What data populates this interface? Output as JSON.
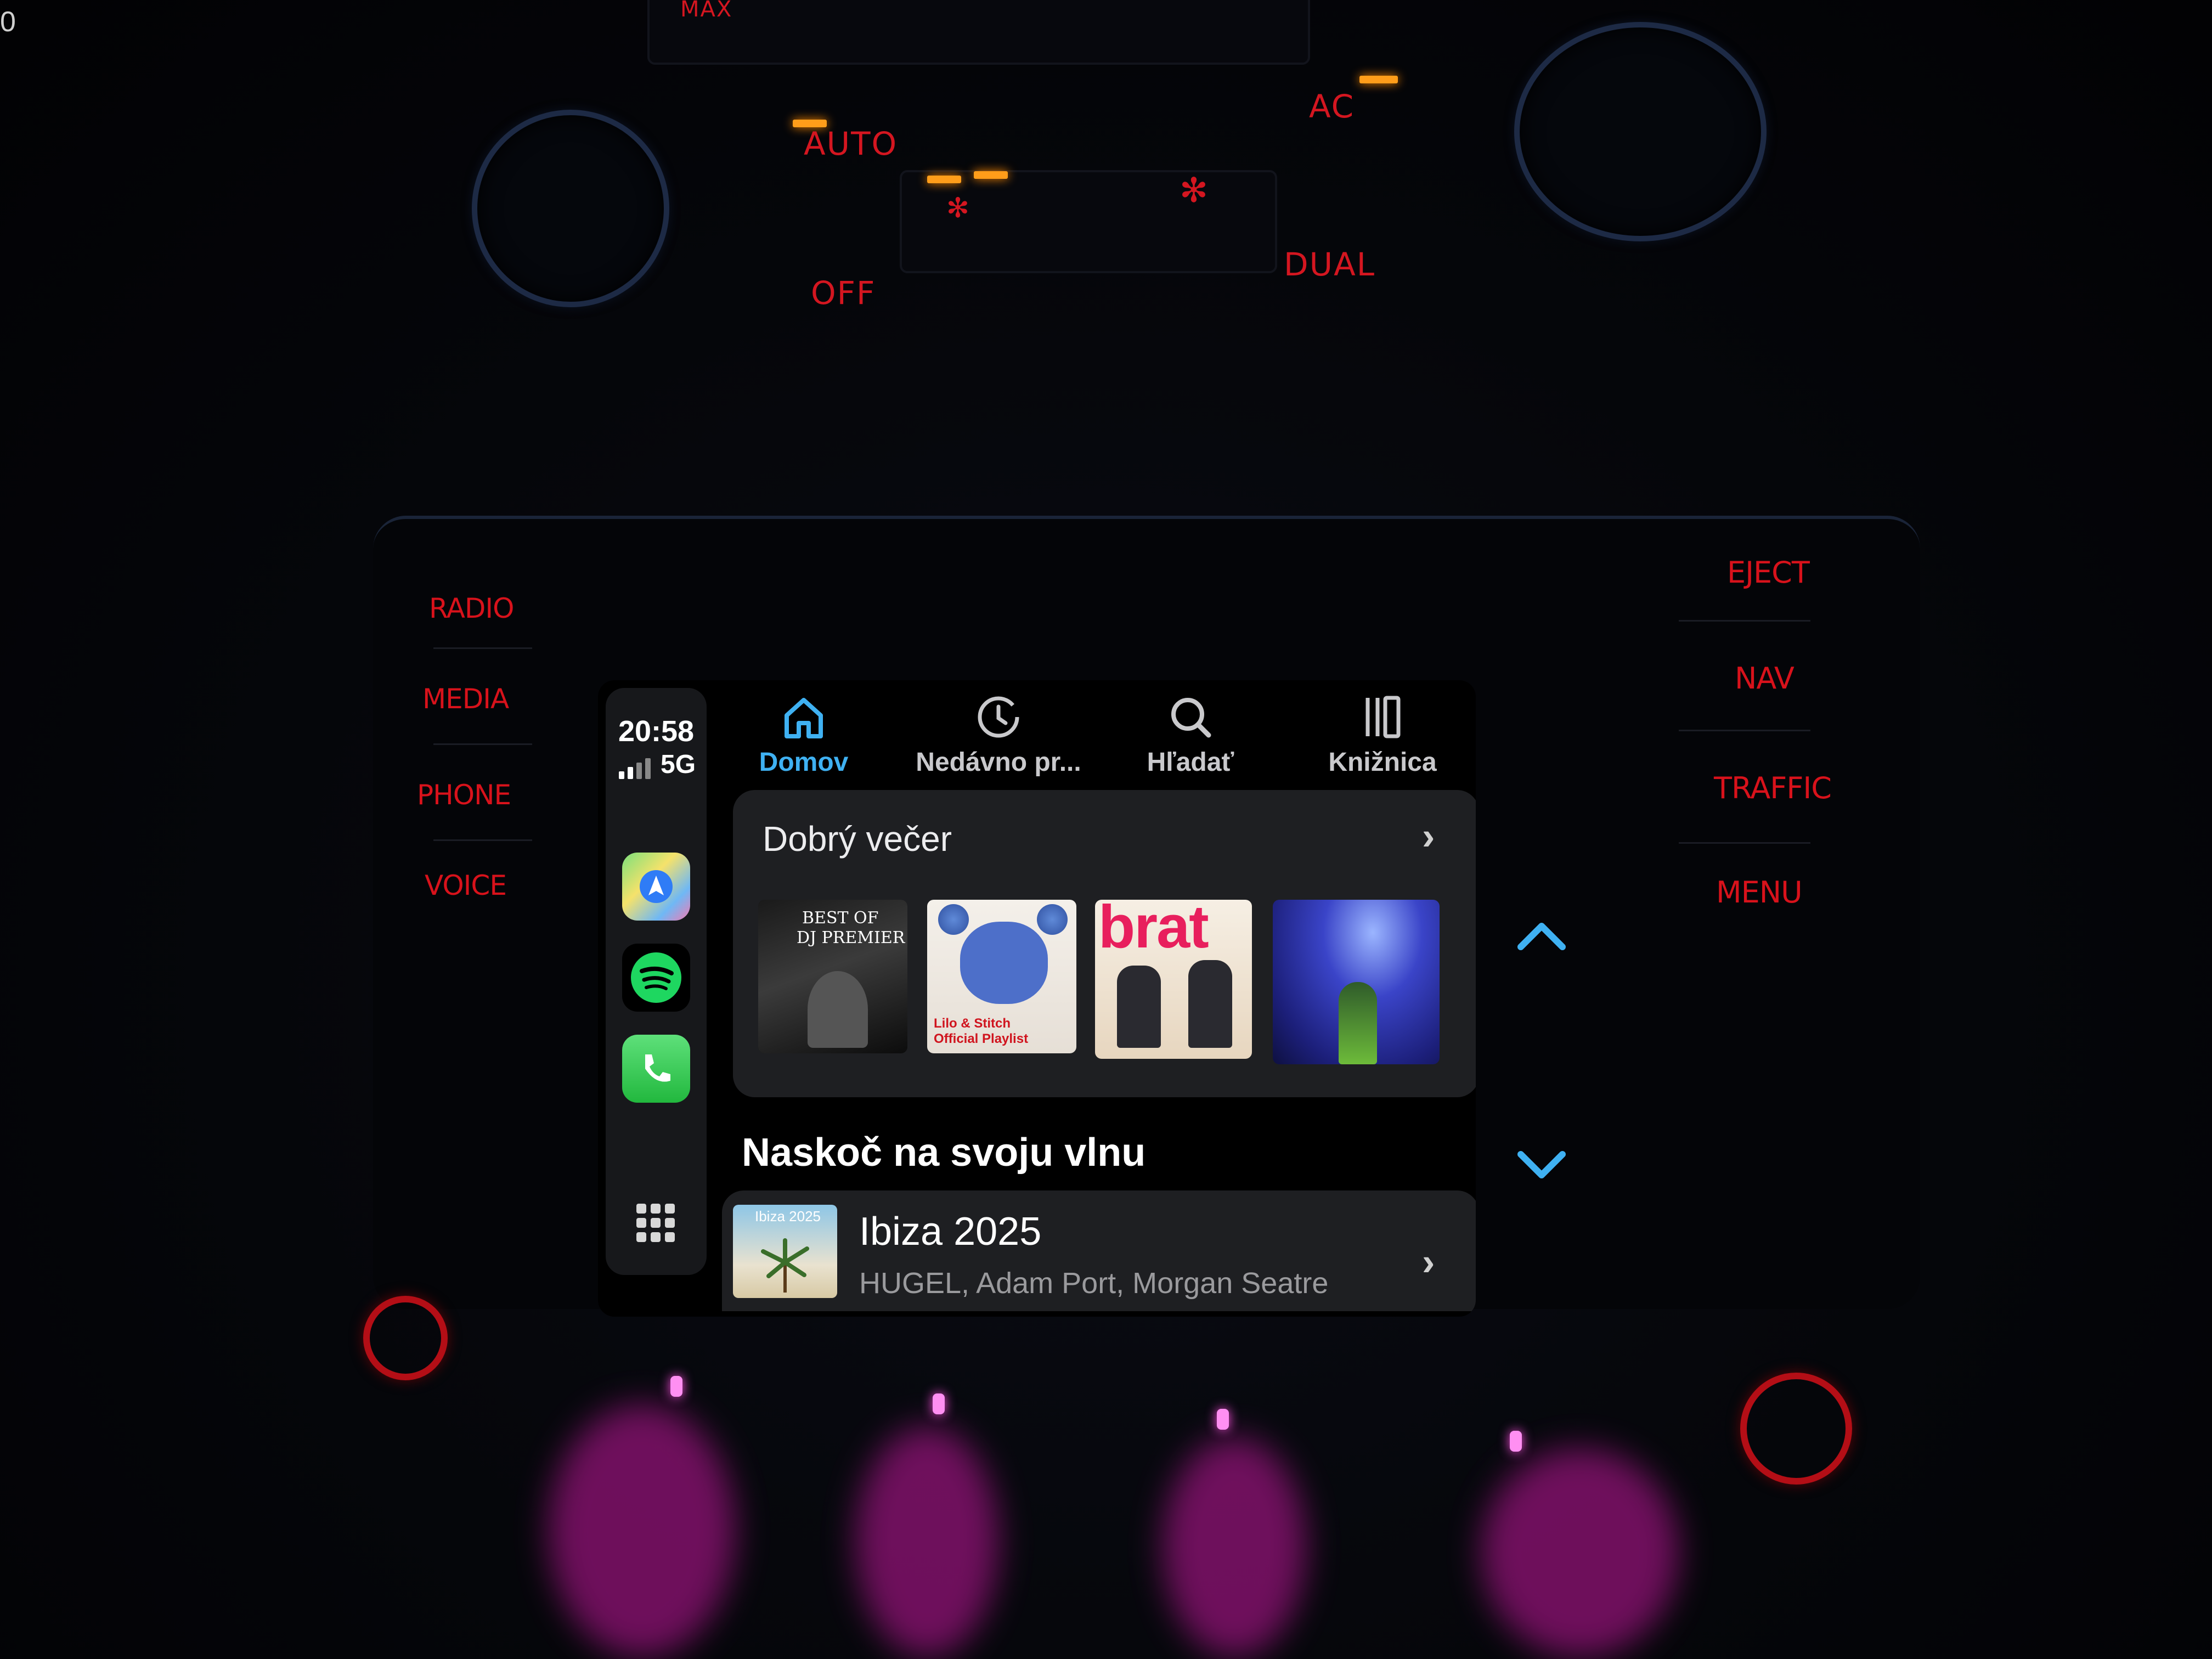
{
  "climate": {
    "max_label": "MAX",
    "auto_label": "AUTO",
    "off_label": "OFF",
    "ac_label": "AC",
    "dual_label": "DUAL"
  },
  "corner_text": "0",
  "hardware": {
    "left_buttons": [
      "RADIO",
      "MEDIA",
      "PHONE",
      "VOICE"
    ],
    "right_buttons": [
      "EJECT",
      "NAV",
      "TRAFFIC",
      "MENU"
    ]
  },
  "status": {
    "time": "20:58",
    "network": "5G"
  },
  "tabs": [
    {
      "label": "Domov",
      "icon": "home-icon",
      "active": true
    },
    {
      "label": "Nedávno pr...",
      "icon": "recent-icon",
      "active": false
    },
    {
      "label": "Hľadať",
      "icon": "search-icon",
      "active": false
    },
    {
      "label": "Knižnica",
      "icon": "library-icon",
      "active": false
    }
  ],
  "greeting_card": {
    "title": "Dobrý večer",
    "tiles": [
      {
        "text_line1": "BEST OF",
        "text_line2": "DJ PREMIER"
      },
      {
        "text_line1": "Lilo & Stitch",
        "text_line2": "Official Playlist"
      },
      {
        "text_line1": "brat",
        "text_line2": ""
      },
      {
        "text_line1": "",
        "text_line2": ""
      }
    ]
  },
  "section": {
    "title": "Naskoč na svoju vlnu",
    "item": {
      "thumb_label": "Ibiza 2025",
      "title": "Ibiza 2025",
      "subtitle": "HUGEL, Adam Port, Morgan Seatre"
    }
  },
  "colors": {
    "accent": "#3fb1f2",
    "panel_red": "#e0121c",
    "card_bg": "#1e1f22",
    "spotify_green": "#1ed760",
    "phone_green": "#2fd158"
  }
}
